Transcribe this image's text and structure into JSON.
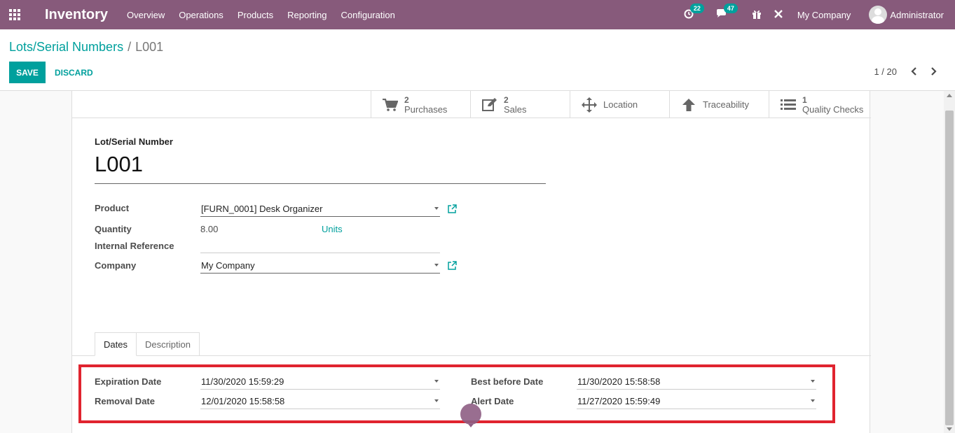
{
  "navbar": {
    "app_title": "Inventory",
    "menu": [
      "Overview",
      "Operations",
      "Products",
      "Reporting",
      "Configuration"
    ],
    "activity_count": "22",
    "messages_count": "47",
    "company": "My Company",
    "user": "Administrator",
    "brand_color": "#875a7b"
  },
  "breadcrumb": {
    "parent": "Lots/Serial Numbers",
    "separator": "/",
    "current": "L001"
  },
  "actions": {
    "save": "SAVE",
    "discard": "DISCARD"
  },
  "pager": {
    "value": "1 / 20"
  },
  "smart_buttons": [
    {
      "icon": "cart-icon",
      "value": "2",
      "label": "Purchases"
    },
    {
      "icon": "edit-icon",
      "value": "2",
      "label": "Sales"
    },
    {
      "icon": "move-icon",
      "label": "Location"
    },
    {
      "icon": "arrow-up-icon",
      "label": "Traceability"
    },
    {
      "icon": "list-icon",
      "value": "1",
      "label": "Quality Checks"
    }
  ],
  "form": {
    "title_label": "Lot/Serial Number",
    "name": "L001",
    "product_label": "Product",
    "product_value": "[FURN_0001] Desk Organizer",
    "quantity_label": "Quantity",
    "quantity_value": "8.00",
    "quantity_uom": "Units",
    "internal_ref_label": "Internal Reference",
    "internal_ref_value": "",
    "company_label": "Company",
    "company_value": "My Company"
  },
  "tabs": [
    "Dates",
    "Description"
  ],
  "dates": {
    "expiration_label": "Expiration Date",
    "expiration_value": "11/30/2020 15:59:29",
    "removal_label": "Removal Date",
    "removal_value": "12/01/2020 15:58:58",
    "best_before_label": "Best before Date",
    "best_before_value": "11/30/2020 15:58:58",
    "alert_label": "Alert Date",
    "alert_value": "11/27/2020 15:59:49"
  },
  "colors": {
    "accent": "#00a09d",
    "highlight_box": "#e0242f"
  }
}
